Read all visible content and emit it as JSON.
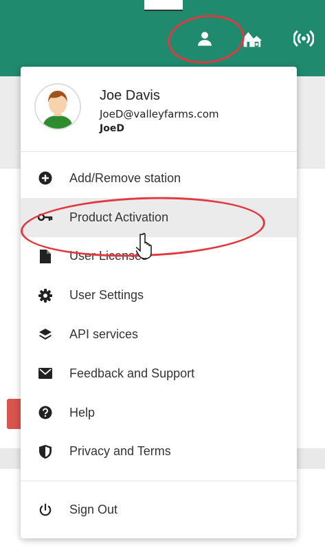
{
  "header": {
    "icons": [
      "user-icon",
      "farm-icon",
      "signal-icon"
    ],
    "accent_color": "#1f8a6e"
  },
  "profile": {
    "name": "Joe Davis",
    "email": "JoeD@valleyfarms.com",
    "username": "JoeD"
  },
  "menu": {
    "items": [
      {
        "label": "Add/Remove station",
        "icon": "plus-circle-icon"
      },
      {
        "label": "Product Activation",
        "icon": "key-icon"
      },
      {
        "label": "User Licenses",
        "icon": "file-icon"
      },
      {
        "label": "User Settings",
        "icon": "gear-icon"
      },
      {
        "label": "API services",
        "icon": "layers-icon"
      },
      {
        "label": "Feedback and Support",
        "icon": "envelope-icon"
      },
      {
        "label": "Help",
        "icon": "question-circle-icon"
      },
      {
        "label": "Privacy and Terms",
        "icon": "shield-icon"
      }
    ],
    "sign_out": {
      "label": "Sign Out",
      "icon": "power-icon"
    }
  },
  "annotation_color": "#e0393f"
}
